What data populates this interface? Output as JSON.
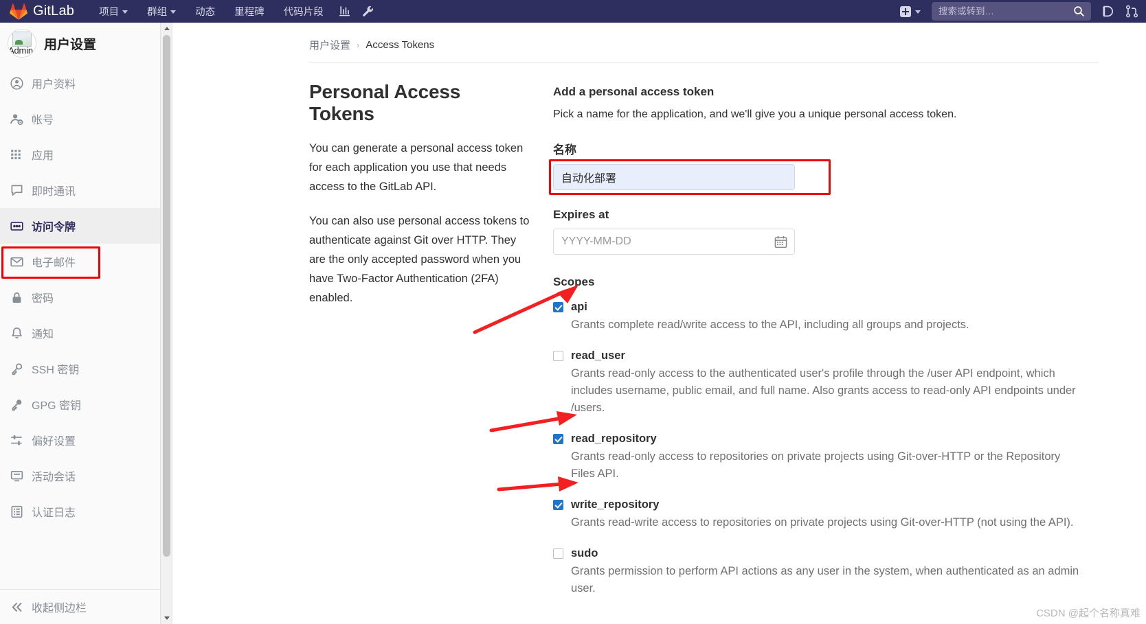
{
  "navbar": {
    "brand": "GitLab",
    "items": [
      {
        "label": "项目",
        "icon": "chevron-down-icon",
        "has_caret": true
      },
      {
        "label": "群组",
        "icon": "chevron-down-icon",
        "has_caret": true
      },
      {
        "label": "动态",
        "has_caret": false
      },
      {
        "label": "里程碑",
        "has_caret": false
      },
      {
        "label": "代码片段",
        "has_caret": false
      }
    ],
    "analytics_icon": "chart-icon",
    "wrench_icon": "wrench-icon",
    "create_icon": "plus-square-icon",
    "create_caret_icon": "chevron-down-icon",
    "search": {
      "placeholder": "搜索或转到…",
      "value": "",
      "icon": "search-icon"
    },
    "issues_icon": "issues-icon",
    "merge_requests_icon": "merge-request-icon",
    "bg_color": "#2e2e5f"
  },
  "sidebar": {
    "avatar_alt": "Admin",
    "title": "用户设置",
    "items": [
      {
        "label": "用户资料",
        "icon": "user-circle-icon",
        "active": false
      },
      {
        "label": "帐号",
        "icon": "account-gear-icon",
        "active": false
      },
      {
        "label": "应用",
        "icon": "applications-grid-icon",
        "active": false
      },
      {
        "label": "即时通讯",
        "icon": "chat-icon",
        "active": false
      },
      {
        "label": "访问令牌",
        "icon": "token-card-icon",
        "active": true
      },
      {
        "label": "电子邮件",
        "icon": "envelope-icon",
        "active": false
      },
      {
        "label": "密码",
        "icon": "lock-icon",
        "active": false
      },
      {
        "label": "通知",
        "icon": "bell-icon",
        "active": false
      },
      {
        "label": "SSH 密钥",
        "icon": "key-icon",
        "active": false
      },
      {
        "label": "GPG 密钥",
        "icon": "key-icon",
        "active": false
      },
      {
        "label": "偏好设置",
        "icon": "preferences-sliders-icon",
        "active": false
      },
      {
        "label": "活动会话",
        "icon": "monitor-icon",
        "active": false
      },
      {
        "label": "认证日志",
        "icon": "log-list-icon",
        "active": false
      }
    ],
    "collapse": {
      "label": "收起侧边栏",
      "icon": "chevron-double-left-icon"
    },
    "highlight_color": "#f10000"
  },
  "breadcrumb": {
    "parent": "用户设置",
    "separator": "›",
    "current": "Access Tokens"
  },
  "left_panel": {
    "title": "Personal Access Tokens",
    "paragraphs": [
      "You can generate a personal access token for each application you use that needs access to the GitLab API.",
      "You can also use personal access tokens to authenticate against Git over HTTP. They are the only accepted password when you have Two-Factor Authentication (2FA) enabled."
    ]
  },
  "form": {
    "title": "Add a personal access token",
    "subtitle": "Pick a name for the application, and we'll give you a unique personal access token.",
    "name_label": "名称",
    "name_value": "自动化部署",
    "name_highlight_color": "#f20505",
    "expires_label": "Expires at",
    "expires_placeholder": "YYYY-MM-DD",
    "expires_value": "",
    "calendar_icon": "calendar-icon",
    "scopes_label": "Scopes",
    "scopes": [
      {
        "name": "api",
        "checked": true,
        "description": "Grants complete read/write access to the API, including all groups and projects."
      },
      {
        "name": "read_user",
        "checked": false,
        "description": "Grants read-only access to the authenticated user's profile through the /user API endpoint, which includes username, public email, and full name. Also grants access to read-only API endpoints under /users."
      },
      {
        "name": "read_repository",
        "checked": true,
        "description": "Grants read-only access to repositories on private projects using Git-over-HTTP or the Repository Files API."
      },
      {
        "name": "write_repository",
        "checked": true,
        "description": "Grants read-write access to repositories on private projects using Git-over-HTTP (not using the API)."
      },
      {
        "name": "sudo",
        "checked": false,
        "description": "Grants permission to perform API actions as any user in the system, when authenticated as an admin user."
      }
    ],
    "checkbox_checked_color": "#1f75cb"
  },
  "annotations": {
    "arrow_color": "#f22020",
    "arrow_count": 3
  },
  "watermark": "CSDN @起个名称真难"
}
